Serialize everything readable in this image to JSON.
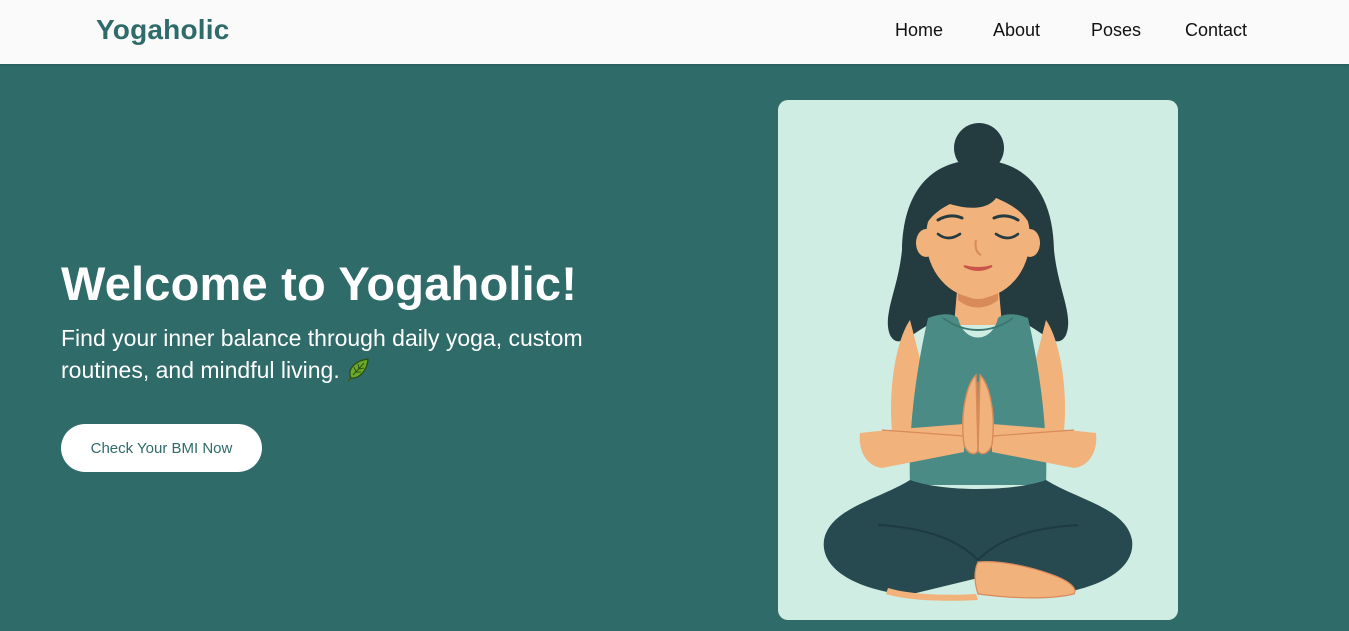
{
  "nav": {
    "logo": "Yogaholic",
    "links": [
      "Home",
      "About",
      "Poses",
      "Contact"
    ]
  },
  "hero": {
    "title": "Welcome to Yogaholic!",
    "subtitle": "Find your inner balance through daily yoga, custom routines, and mindful living.",
    "subtitle_icon": "leaf-icon",
    "cta_label": "Check Your BMI Now",
    "illustration": "meditating-woman-illustration"
  },
  "colors": {
    "brand": "#2e6b69",
    "navbar_bg": "#fafafa",
    "card_bg": "#cfede3",
    "button_bg": "#ffffff"
  }
}
